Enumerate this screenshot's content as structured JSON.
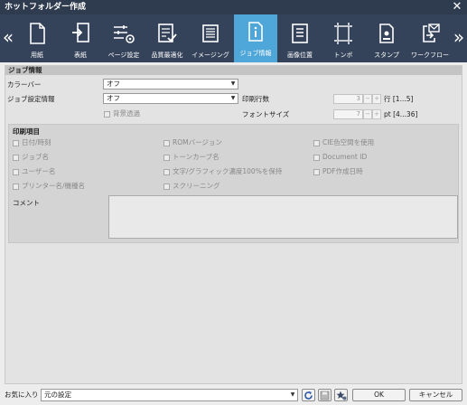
{
  "window": {
    "title": "ホットフォルダー作成",
    "close_glyph": "✕"
  },
  "toolbar": {
    "prev_glyph": "«",
    "next_glyph": "»",
    "items": [
      {
        "label": "用紙",
        "icon": "paper-icon",
        "active": false
      },
      {
        "label": "表紙",
        "icon": "cover-icon",
        "active": false
      },
      {
        "label": "ページ設定",
        "icon": "page-setup-icon",
        "active": false
      },
      {
        "label": "品質最適化",
        "icon": "quality-icon",
        "active": false
      },
      {
        "label": "イメージング",
        "icon": "imaging-icon",
        "active": false
      },
      {
        "label": "ジョブ情報",
        "icon": "job-info-icon",
        "active": true
      },
      {
        "label": "画像位置",
        "icon": "image-position-icon",
        "active": false
      },
      {
        "label": "トンボ",
        "icon": "crop-marks-icon",
        "active": false
      },
      {
        "label": "スタンプ",
        "icon": "stamp-icon",
        "active": false
      },
      {
        "label": "ワークフロー",
        "icon": "workflow-icon",
        "active": false
      }
    ],
    "active_color": "#4fa6d8",
    "bar_color": "#34435a"
  },
  "job_info": {
    "section_title": "ジョブ情報",
    "color_bar_label": "カラーバー",
    "color_bar_value": "オフ",
    "job_settings_label": "ジョブ設定情報",
    "job_settings_value": "オフ",
    "background_transparent_label": "背景透過",
    "print_lines_label": "印刷行数",
    "print_lines_value": "3",
    "print_lines_range": "行 [1...5]",
    "font_size_label": "フォントサイズ",
    "font_size_value": "7",
    "font_size_range": "pt [4...36]",
    "minus": "−",
    "plus": "+"
  },
  "print_items": {
    "title": "印刷項目",
    "col1": [
      "日付/時刻",
      "ジョブ名",
      "ユーザー名",
      "プリンター名/機種名"
    ],
    "col2": [
      "ROMバージョン",
      "トーンカーブ名",
      "文字/グラフィック濃度100%を保持",
      "スクリーニング"
    ],
    "col3": [
      "CIE色空間を使用",
      "Document ID",
      "PDF作成日時"
    ],
    "comment_label": "コメント"
  },
  "footer": {
    "favorites_label": "お気に入り",
    "favorites_value": "元の設定",
    "ok_label": "OK",
    "cancel_label": "キャンセル"
  }
}
